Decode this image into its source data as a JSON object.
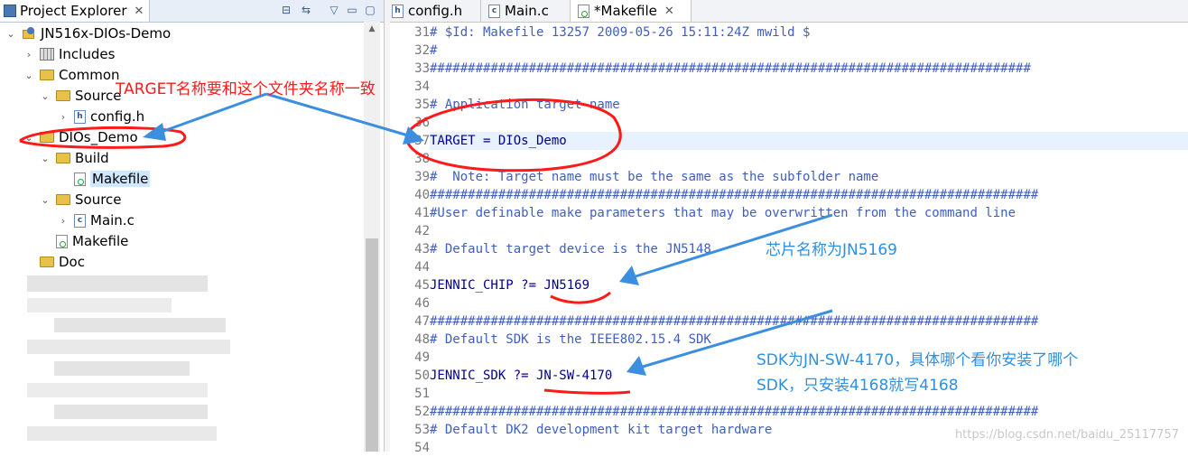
{
  "left_pane": {
    "view_title": "Project Explorer",
    "tree": [
      {
        "label": "JN516x-DIOs-Demo",
        "kind": "project",
        "twisty": "open"
      },
      {
        "label": "Includes",
        "kind": "includes",
        "twisty": "closed"
      },
      {
        "label": "Common",
        "kind": "folder",
        "twisty": "open"
      },
      {
        "label": "Source",
        "kind": "folder",
        "twisty": "open"
      },
      {
        "label": "config.h",
        "kind": "file-h",
        "twisty": "closed"
      },
      {
        "label": "DIOs_Demo",
        "kind": "folder",
        "twisty": "open"
      },
      {
        "label": "Build",
        "kind": "folder",
        "twisty": "open"
      },
      {
        "label": "Makefile",
        "kind": "file-mk",
        "twisty": "none",
        "selected": true
      },
      {
        "label": "Source",
        "kind": "folder",
        "twisty": "open"
      },
      {
        "label": "Main.c",
        "kind": "file-c",
        "twisty": "closed"
      },
      {
        "label": "Makefile",
        "kind": "file-mk",
        "twisty": "none"
      },
      {
        "label": "Doc",
        "kind": "folder",
        "twisty": "none"
      }
    ]
  },
  "editor": {
    "tabs": [
      {
        "label": "config.h",
        "icon": "header-file-icon"
      },
      {
        "label": "Main.c",
        "icon": "c-file-icon"
      },
      {
        "label": "*Makefile",
        "icon": "makefile-icon",
        "active": true
      }
    ],
    "lines": [
      {
        "n": "31",
        "text": "# $Id: Makefile 13257 2009-05-26 15:11:24Z mwild $",
        "style": "cm"
      },
      {
        "n": "32",
        "text": "#",
        "style": "cm"
      },
      {
        "n": "33",
        "text": "###############################################################################",
        "style": "cm"
      },
      {
        "n": "34",
        "text": "",
        "style": ""
      },
      {
        "n": "35",
        "text": "# Application target name",
        "style": "cm"
      },
      {
        "n": "36",
        "text": "",
        "style": ""
      },
      {
        "n": "37",
        "text": "TARGET = DIOs_Demo",
        "style": "kw",
        "highlight": true
      },
      {
        "n": "38",
        "text": "",
        "style": ""
      },
      {
        "n": "39",
        "text": "#  Note: Target name must be the same as the subfolder name",
        "style": "cm"
      },
      {
        "n": "40",
        "text": "################################################################################",
        "style": "cm"
      },
      {
        "n": "41",
        "text": "#User definable make parameters that may be overwritten from the command line",
        "style": "cm"
      },
      {
        "n": "42",
        "text": "",
        "style": ""
      },
      {
        "n": "43",
        "text": "# Default target device is the JN5148",
        "style": "cm"
      },
      {
        "n": "44",
        "text": "",
        "style": ""
      },
      {
        "n": "45",
        "text": "JENNIC_CHIP ?= JN5169",
        "style": "kw"
      },
      {
        "n": "46",
        "text": "",
        "style": ""
      },
      {
        "n": "47",
        "text": "################################################################################",
        "style": "cm"
      },
      {
        "n": "48",
        "text": "# Default SDK is the IEEE802.15.4 SDK",
        "style": "cm"
      },
      {
        "n": "49",
        "text": "",
        "style": ""
      },
      {
        "n": "50",
        "text": "JENNIC_SDK ?= JN-SW-4170",
        "style": "kw"
      },
      {
        "n": "51",
        "text": "",
        "style": ""
      },
      {
        "n": "52",
        "text": "################################################################################",
        "style": "cm"
      },
      {
        "n": "53",
        "text": "# Default DK2 development kit target hardware",
        "style": "cm"
      },
      {
        "n": "54",
        "text": "",
        "style": ""
      }
    ]
  },
  "annotations": {
    "target_note": "TARGET名称要和这个文件夹名称一致",
    "chip_note": "芯片名称为JN5169",
    "sdk_note_line1": "SDK为JN-SW-4170，具体哪个看你安装了哪个",
    "sdk_note_line2": "SDK，只安装4168就写4168"
  },
  "watermark": "https://blog.csdn.net/baidu_25117757",
  "colors": {
    "annotation_red": "#ff1a1a",
    "annotation_blue": "#2f8fe0",
    "arrow_blue": "#3b8ee0",
    "comment_blue": "#3f5fbf"
  }
}
